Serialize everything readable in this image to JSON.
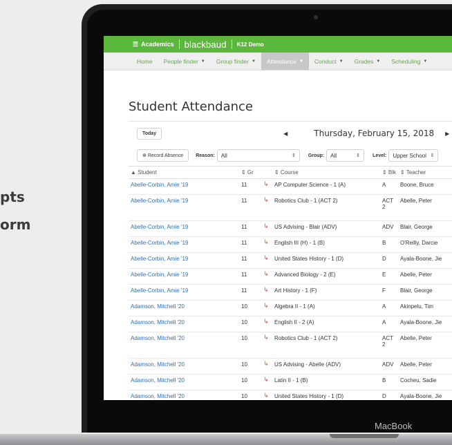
{
  "left_fragments": [
    "pts",
    "orm"
  ],
  "device": {
    "brand": "MacBook"
  },
  "topbar": {
    "menu_icon": "hamburger-icon",
    "menu_label": "Academics",
    "logo": "blackbaud",
    "logo_suffix": "K12 Demo"
  },
  "nav": [
    {
      "label": "Home",
      "caret": false
    },
    {
      "label": "People finder",
      "caret": true
    },
    {
      "label": "Group finder",
      "caret": true
    },
    {
      "label": "Attendance",
      "caret": true,
      "active": true
    },
    {
      "label": "Conduct",
      "caret": true
    },
    {
      "label": "Grades",
      "caret": true
    },
    {
      "label": "Scheduling",
      "caret": true
    }
  ],
  "page_title": "Student Attendance",
  "date_bar": {
    "today_label": "Today",
    "prev_icon": "triangle-left-icon",
    "date": "Thursday, February 15, 2018",
    "next_icon": "triangle-right-icon"
  },
  "filters": {
    "record_absence_label": "Record Absence",
    "reason_label": "Reason:",
    "reason_value": "All",
    "group_label": "Group:",
    "group_value": "All",
    "level_label": "Level:",
    "level_value": "Upper School"
  },
  "table": {
    "headers": {
      "student": "▲ Student",
      "gr": "⇕ Gr",
      "course": "⇕ Course",
      "blk": "⇕ Blk",
      "teacher": "⇕ Teacher"
    },
    "rows": [
      {
        "student": "Abelle-Corbin, Amie '19",
        "gr": "11",
        "course": "AP Computer Science - 1 (A)",
        "blk": "A",
        "teacher": "Boone, Bruce"
      },
      {
        "student": "Abelle-Corbin, Amie '19",
        "gr": "11",
        "course": "Robotics Club - 1 (ACT 2)",
        "blk": "ACT 2",
        "teacher": "Abelle, Peter",
        "tall": true
      },
      {
        "student": "Abelle-Corbin, Amie '19",
        "gr": "11",
        "course": "US Advising - Blair (ADV)",
        "blk": "ADV",
        "teacher": "Blair, George"
      },
      {
        "student": "Abelle-Corbin, Amie '19",
        "gr": "11",
        "course": "English III (H) - 1 (B)",
        "blk": "B",
        "teacher": "O'Reilly, Darcie"
      },
      {
        "student": "Abelle-Corbin, Amie '19",
        "gr": "11",
        "course": "United States History - 1 (D)",
        "blk": "D",
        "teacher": "Ayala-Boone, Jie"
      },
      {
        "student": "Abelle-Corbin, Amie '19",
        "gr": "11",
        "course": "Advanced Biology - 2 (E)",
        "blk": "E",
        "teacher": "Abelle, Peter"
      },
      {
        "student": "Abelle-Corbin, Amie '19",
        "gr": "11",
        "course": "Art History - 1 (F)",
        "blk": "F",
        "teacher": "Blair, George"
      },
      {
        "student": "Adamson, Mitchell '20",
        "gr": "10",
        "course": "Algebra II - 1 (A)",
        "blk": "A",
        "teacher": "Akinpelu, Tim"
      },
      {
        "student": "Adamson, Mitchell '20",
        "gr": "10",
        "course": "English II - 2 (A)",
        "blk": "A",
        "teacher": "Ayala-Boone, Jie"
      },
      {
        "student": "Adamson, Mitchell '20",
        "gr": "10",
        "course": "Robotics Club - 1 (ACT 2)",
        "blk": "ACT 2",
        "teacher": "Abelle, Peter",
        "tall": true
      },
      {
        "student": "Adamson, Mitchell '20",
        "gr": "10",
        "course": "US Advising - Abelle (ADV)",
        "blk": "ADV",
        "teacher": "Abelle, Peter"
      },
      {
        "student": "Adamson, Mitchell '20",
        "gr": "10",
        "course": "Latin II - 1 (B)",
        "blk": "B",
        "teacher": "Cocheu, Sadie"
      },
      {
        "student": "Adamson, Mitchell '20",
        "gr": "10",
        "course": "United States History - 1 (D)",
        "blk": "D",
        "teacher": "Ayala-Boone, Jie"
      }
    ]
  },
  "colors": {
    "brand_green": "#5cb83c",
    "link_blue": "#2c6fb7",
    "icon_red": "#e34a2f"
  }
}
